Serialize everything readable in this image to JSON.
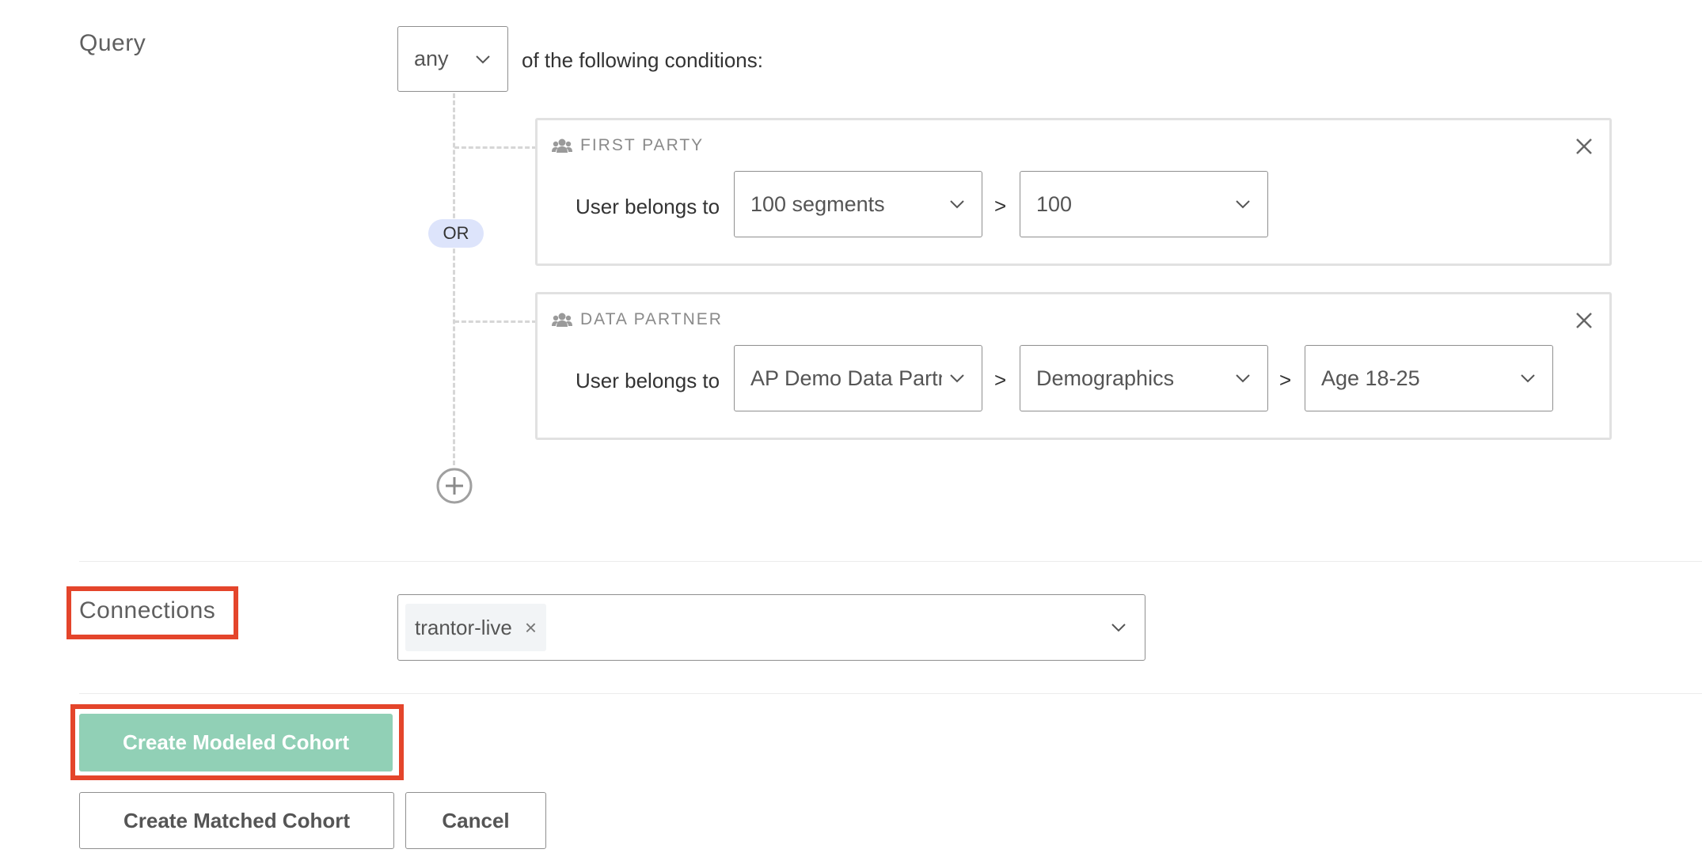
{
  "query": {
    "label": "Query",
    "match_select": {
      "value": "any"
    },
    "match_suffix": "of the following conditions:",
    "or_label": "OR",
    "conditions": [
      {
        "title": "FIRST PARTY",
        "icon": "users-icon",
        "prefix": "User belongs to",
        "selects": [
          "100 segments",
          "100"
        ],
        "separator": ">"
      },
      {
        "title": "DATA PARTNER",
        "icon": "users-icon",
        "prefix": "User belongs to",
        "selects": [
          "AP Demo Data Partner",
          "Demographics",
          "Age 18-25"
        ],
        "separator": ">"
      }
    ]
  },
  "connections": {
    "label": "Connections",
    "tags": [
      {
        "label": "trantor-live",
        "remove": "×"
      }
    ]
  },
  "actions": {
    "create_modeled": "Create Modeled Cohort",
    "create_matched": "Create Matched Cohort",
    "cancel": "Cancel"
  },
  "colors": {
    "primary_button": "#91d0b6",
    "highlight": "#e4452b",
    "or_pill": "#dde4fb"
  }
}
